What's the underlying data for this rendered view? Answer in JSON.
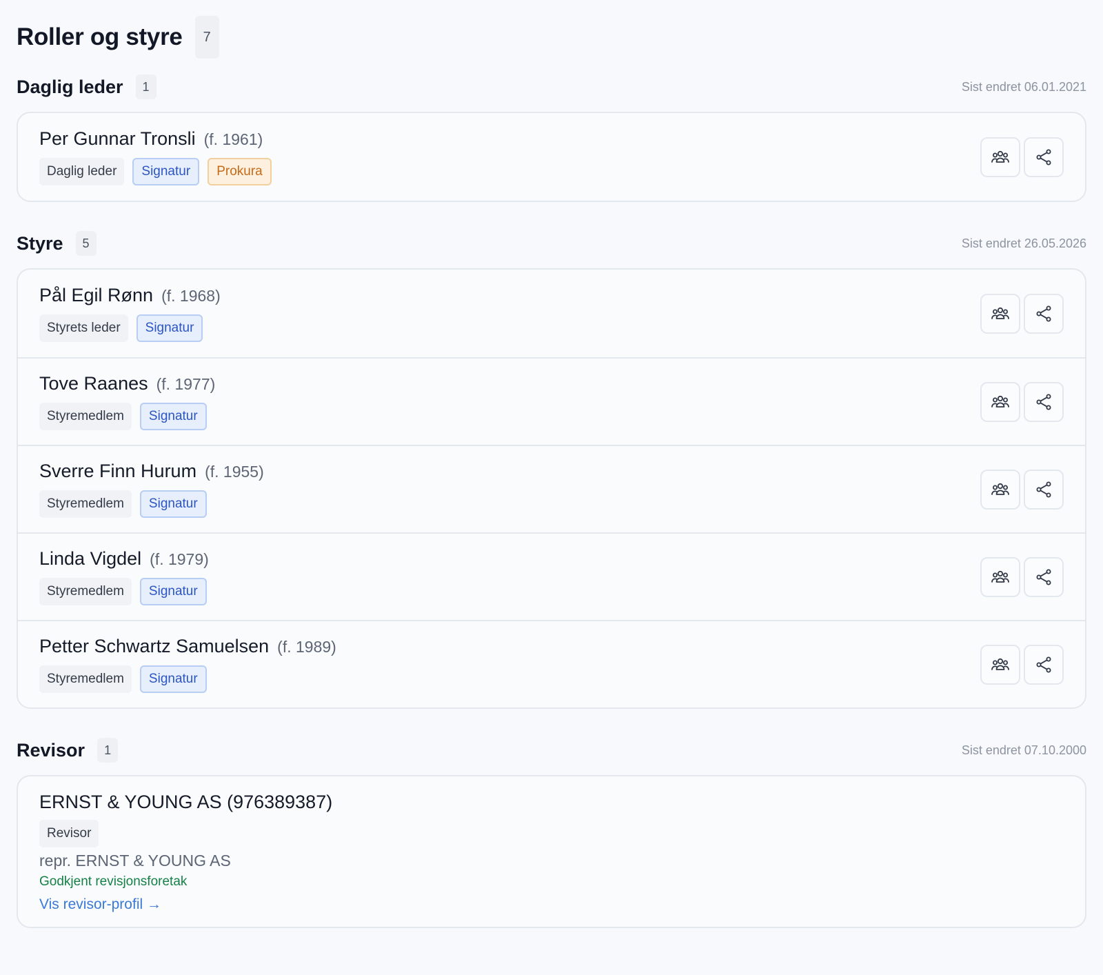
{
  "page": {
    "title": "Roller og styre",
    "count": "7"
  },
  "daglig_leder": {
    "title": "Daglig leder",
    "count": "1",
    "last_changed": "Sist endret 06.01.2021",
    "people": [
      {
        "name": "Per Gunnar Tronsli",
        "birth": "(f. 1961)",
        "role": "Daglig leder",
        "signatur": "Signatur",
        "prokura": "Prokura"
      }
    ]
  },
  "styre": {
    "title": "Styre",
    "count": "5",
    "last_changed": "Sist endret 26.05.2026",
    "people": [
      {
        "name": "Pål Egil Rønn",
        "birth": "(f. 1968)",
        "role": "Styrets leder",
        "signatur": "Signatur"
      },
      {
        "name": "Tove Raanes",
        "birth": "(f. 1977)",
        "role": "Styremedlem",
        "signatur": "Signatur"
      },
      {
        "name": "Sverre Finn Hurum",
        "birth": "(f. 1955)",
        "role": "Styremedlem",
        "signatur": "Signatur"
      },
      {
        "name": "Linda Vigdel",
        "birth": "(f. 1979)",
        "role": "Styremedlem",
        "signatur": "Signatur"
      },
      {
        "name": "Petter Schwartz Samuelsen",
        "birth": "(f. 1989)",
        "role": "Styremedlem",
        "signatur": "Signatur"
      }
    ]
  },
  "revisor": {
    "title": "Revisor",
    "count": "1",
    "last_changed": "Sist endret 07.10.2000",
    "name": "ERNST & YOUNG AS (976389387)",
    "role": "Revisor",
    "repr": "repr. ERNST & YOUNG AS",
    "approved": "Godkjent revisjonsforetak",
    "profile_link": "Vis revisor-profil →"
  },
  "icons": {
    "group": "group-icon",
    "share": "share-icon"
  },
  "colors": {
    "signatur": "#2c55c4",
    "prokura": "#c76a16",
    "approved": "#168046",
    "link": "#3b79d6"
  }
}
